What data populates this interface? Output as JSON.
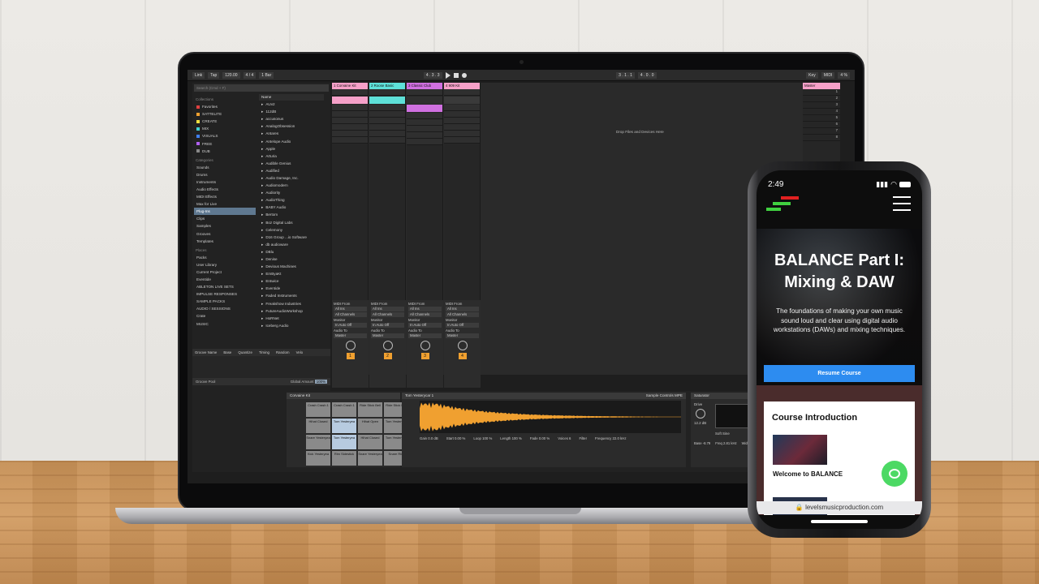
{
  "colors": {
    "accent_blue": "#2d8cf0",
    "chat_green": "#4cd964",
    "clip_pink": "#f5a0c8",
    "clip_cyan": "#5ee0d8",
    "clip_magenta": "#d070e0",
    "track_orange": "#f0a030"
  },
  "daw": {
    "topbar": {
      "link": "Link",
      "tap": "Tap",
      "tempo": "120.00",
      "signature": "4 / 4",
      "quant": "1 Bar",
      "position": "4 .  3 .  3",
      "loop_start": "3 .  1 .  1",
      "loop_length": "4 .  0 .  0",
      "key": "Key",
      "midi": "MIDI",
      "cpu": "4 %"
    },
    "browser": {
      "search_placeholder": "Search (Cmd + F)",
      "collections_header": "Collections",
      "collections": [
        {
          "label": "Favorites",
          "color": "#e04040"
        },
        {
          "label": "SATTELITE",
          "color": "#f0a030"
        },
        {
          "label": "CREATE",
          "color": "#f0e040"
        },
        {
          "label": "MIX",
          "color": "#40d0d0"
        },
        {
          "label": "VISUALS",
          "color": "#4080f0"
        },
        {
          "label": "FREE",
          "color": "#b060f0"
        },
        {
          "label": "DUB",
          "color": "#888888"
        }
      ],
      "categories_header": "Categories",
      "categories": [
        "Sounds",
        "Drums",
        "Instruments",
        "Audio Effects",
        "MIDI Effects",
        "Max for Live",
        "Plug-Ins",
        "Clips",
        "Samples",
        "Grooves",
        "Templates"
      ],
      "selected_category": "Plug-Ins",
      "places_header": "Places",
      "places": [
        "Packs",
        "User Library",
        "Current Project",
        "Eventide",
        "ABLETON LIVE SETS",
        "IMPULSE RESPONSES",
        "SAMPLE PACKS",
        "AUDIO / SESSIONS",
        "Crate",
        "MUSIC"
      ],
      "name_header": "Name",
      "names": [
        "AUv2",
        "112dB",
        "accusonus",
        "AnalogObsession",
        "Antares",
        "Antelope Audio",
        "Apple",
        "Arturia",
        "Audible Genius",
        "Audified",
        "Audio Damage, Inc.",
        "Audiomodern",
        "Audiority",
        "AudioThing",
        "BABY Audio",
        "Bertom",
        "Boz Digital Labs",
        "Celemony",
        "D16 Group ...io Software",
        "db audioware",
        "DBlu",
        "Denise",
        "Devious Machines",
        "EmByaKt",
        "Entwice",
        "Eventide",
        "Faded Instruments",
        "Freakshow Industries",
        "FutureAudioWorkshop",
        "HoRNet",
        "Iceberg Audio"
      ]
    },
    "groove": {
      "headers": [
        "Groove Name",
        "Base",
        "Quantize",
        "Timing",
        "Random",
        "Velo"
      ],
      "pool": "Groove Pool",
      "amount_label": "Global Amount",
      "amount_value": "100%"
    },
    "tracks": [
      {
        "name": "1 Corvaine Kit",
        "color": "#f5a0c8",
        "num": "1"
      },
      {
        "name": "2 Roose Basic",
        "color": "#5ee0d8",
        "num": "2"
      },
      {
        "name": "3 Classic Club",
        "color": "#d070e0",
        "num": "3"
      },
      {
        "name": "4 909 Kit",
        "color": "#f5a0c8",
        "num": "4"
      }
    ],
    "mixer": {
      "midi_from": "MIDI From",
      "all_ins": "All Ins",
      "all_channels": "All Channels",
      "monitor": "Monitor",
      "monitor_opts": "In  Auto  Off",
      "audio_to": "Audio To",
      "master": "Master"
    },
    "drop_text": "Drop Files and Devices Here",
    "master_track": {
      "name": "Master",
      "scenes": [
        "1",
        "2",
        "3",
        "4",
        "5",
        "6",
        "7",
        "8"
      ]
    },
    "devices": {
      "drum_rack_title": "Corvaine Kit",
      "pads": [
        "Crash Crash 1",
        "Crash Crash 1",
        "Ride Stick Bell",
        "Ride Stick Mid",
        "Hihat Closed",
        "Tom Yesteryea",
        "Hihat Open",
        "Tom Yesteryea",
        "Snare Yesteryea",
        "Tom Yesteryea",
        "Hihat Closed",
        "Tom Yesteryea",
        "Kick Yesteryea",
        "Rim Sidestick",
        "Snare Yesteryea",
        "Snare Rim"
      ],
      "simpler_title": "Tom Yesterycar 1",
      "simpler_tabs": "Sample  Controls  MPE",
      "params": [
        "Gain 0.0 dB",
        "Start 0.00 %",
        "Loop 100 %",
        "Length 100 %",
        "Fade 0.00 %",
        "Voices 6",
        "Filter",
        "Frequency 22.0 kHz",
        "Res 24 %",
        "LFO",
        "Attack 0.00 ms",
        "Decay 1.00 ms",
        "Sustain 0.0 dB",
        "Release 29.6 s",
        "Volume -11.9 dB"
      ],
      "saturator_title": "Saturator",
      "drive": "Drive",
      "drive_val": "12.2 dB",
      "soft_sine": "Soft Sine",
      "base_params": [
        "Base -8.79",
        "Freq 2.81 kHz",
        "Width 75 %"
      ]
    }
  },
  "phone": {
    "time": "2:49",
    "hero_title": "BALANCE Part I: Mixing & DAW",
    "hero_sub": "The foundations of making your own music sound loud and clear using digital audio workstations (DAWs) and mixing techniques.",
    "resume_button": "Resume Course",
    "course_heading": "Course Introduction",
    "course_item": "Welcome to BALANCE",
    "url": "levelsmusicproduction.com"
  }
}
